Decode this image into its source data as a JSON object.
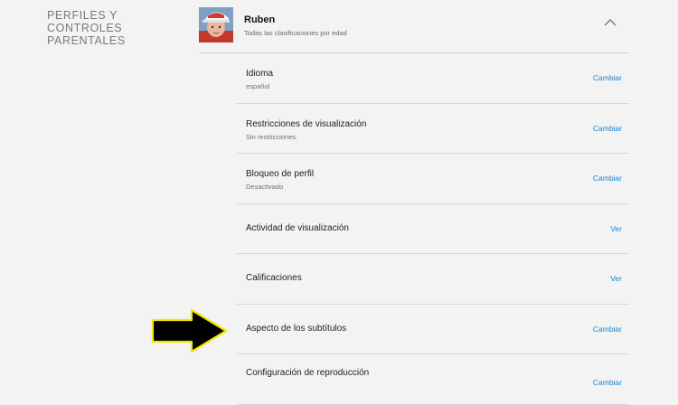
{
  "section": {
    "title": "PERFILES Y CONTROLES PARENTALES"
  },
  "profile": {
    "name": "Ruben",
    "subtitle": "Todas las clasificaciones por edad"
  },
  "settings": [
    {
      "label": "Idioma",
      "sub": "español",
      "action": "Cambiar"
    },
    {
      "label": "Restricciones de visualización",
      "sub": "Sin restricciones.",
      "action": "Cambiar"
    },
    {
      "label": "Bloqueo de perfil",
      "sub": "Desactivado",
      "action": "Cambiar"
    },
    {
      "label": "Actividad de visualización",
      "sub": "",
      "action": "Ver"
    },
    {
      "label": "Calificaciones",
      "sub": "",
      "action": "Ver"
    },
    {
      "label": "Aspecto de los subtítulos",
      "sub": "",
      "action": "Cambiar"
    },
    {
      "label": "Configuración de reproducción",
      "sub": "",
      "action": "Cambiar"
    }
  ],
  "colors": {
    "background": "#f3f3f3",
    "link": "#1a86d0",
    "divider": "#d6d6d6",
    "arrow_fill": "#000000",
    "arrow_outline": "#f2e600"
  },
  "icons": {
    "avatar": "kid-avatar",
    "collapse": "chevron-up-icon",
    "pointer": "arrow-right-icon"
  }
}
